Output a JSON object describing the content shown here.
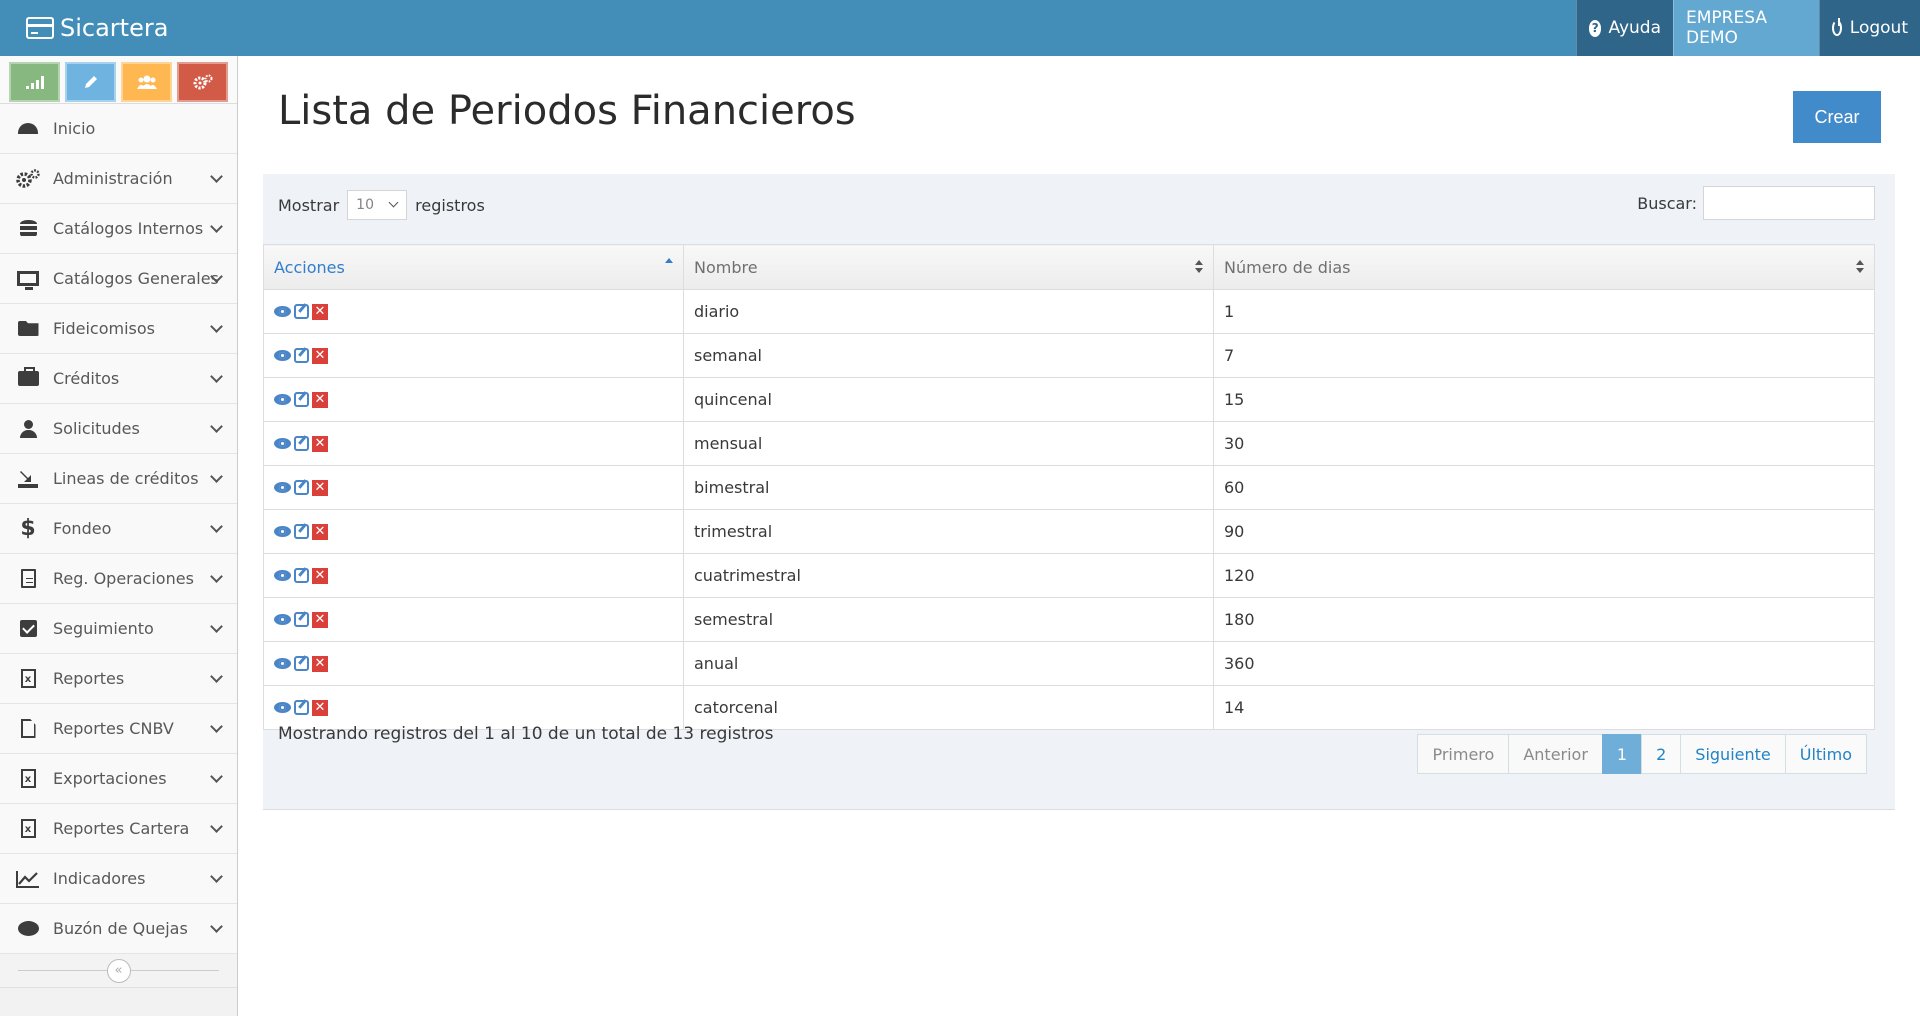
{
  "app": {
    "brand": "Sicartera"
  },
  "topnav": {
    "help_label": "Ayuda",
    "company_label": "EMPRESA DEMO",
    "logout_label": "Logout"
  },
  "shortcuts": [
    {
      "name": "signal-icon",
      "color": "#87b87f"
    },
    {
      "name": "pencil-icon",
      "color": "#6fb3e0"
    },
    {
      "name": "users-icon",
      "color": "#ffb752"
    },
    {
      "name": "cogs-icon",
      "color": "#d15b47"
    }
  ],
  "sidebar": {
    "items": [
      {
        "label": "Inicio",
        "icon": "dashboard-icon"
      },
      {
        "label": "Administración",
        "icon": "cogs-icon"
      },
      {
        "label": "Catálogos Internos",
        "icon": "database-icon"
      },
      {
        "label": "Catálogos Generales",
        "icon": "desktop-icon"
      },
      {
        "label": "Fideicomisos",
        "icon": "folder-open-icon"
      },
      {
        "label": "Créditos",
        "icon": "briefcase-icon"
      },
      {
        "label": "Solicitudes",
        "icon": "user-icon"
      },
      {
        "label": "Lineas de créditos",
        "icon": "download-icon"
      },
      {
        "label": "Fondeo",
        "icon": "dollar-icon"
      },
      {
        "label": "Reg. Operaciones",
        "icon": "file-text-icon"
      },
      {
        "label": "Seguimiento",
        "icon": "check-square-icon"
      },
      {
        "label": "Reportes",
        "icon": "file-excel-icon"
      },
      {
        "label": "Reportes CNBV",
        "icon": "file-icon"
      },
      {
        "label": "Exportaciones",
        "icon": "file-excel-icon"
      },
      {
        "label": "Reportes Cartera",
        "icon": "file-excel-icon"
      },
      {
        "label": "Indicadores",
        "icon": "line-chart-icon"
      },
      {
        "label": "Buzón de Quejas",
        "icon": "comment-icon"
      }
    ]
  },
  "page": {
    "title": "Lista de Periodos Financieros",
    "create_label": "Crear"
  },
  "table_controls": {
    "show_label": "Mostrar",
    "page_size": "10",
    "records_label": "registros",
    "search_label": "Buscar:",
    "search_value": ""
  },
  "table": {
    "columns": [
      "Acciones",
      "Nombre",
      "Número de dias"
    ],
    "rows": [
      {
        "nombre": "diario",
        "dias": "1"
      },
      {
        "nombre": "semanal",
        "dias": "7"
      },
      {
        "nombre": "quincenal",
        "dias": "15"
      },
      {
        "nombre": "mensual",
        "dias": "30"
      },
      {
        "nombre": "bimestral",
        "dias": "60"
      },
      {
        "nombre": "trimestral",
        "dias": "90"
      },
      {
        "nombre": "cuatrimestral",
        "dias": "120"
      },
      {
        "nombre": "semestral",
        "dias": "180"
      },
      {
        "nombre": "anual",
        "dias": "360"
      },
      {
        "nombre": "catorcenal",
        "dias": "14"
      }
    ]
  },
  "footer": {
    "info": "Mostrando registros del 1 al 10 de un total de 13 registros",
    "pagination": {
      "first": "Primero",
      "prev": "Anterior",
      "pages": [
        "1",
        "2"
      ],
      "next": "Siguiente",
      "last": "Último"
    }
  },
  "colors": {
    "navbar": "#438eb9",
    "primary_button": "#428bca",
    "active_page": "#6faed9",
    "delete_icon": "#d9403a"
  }
}
